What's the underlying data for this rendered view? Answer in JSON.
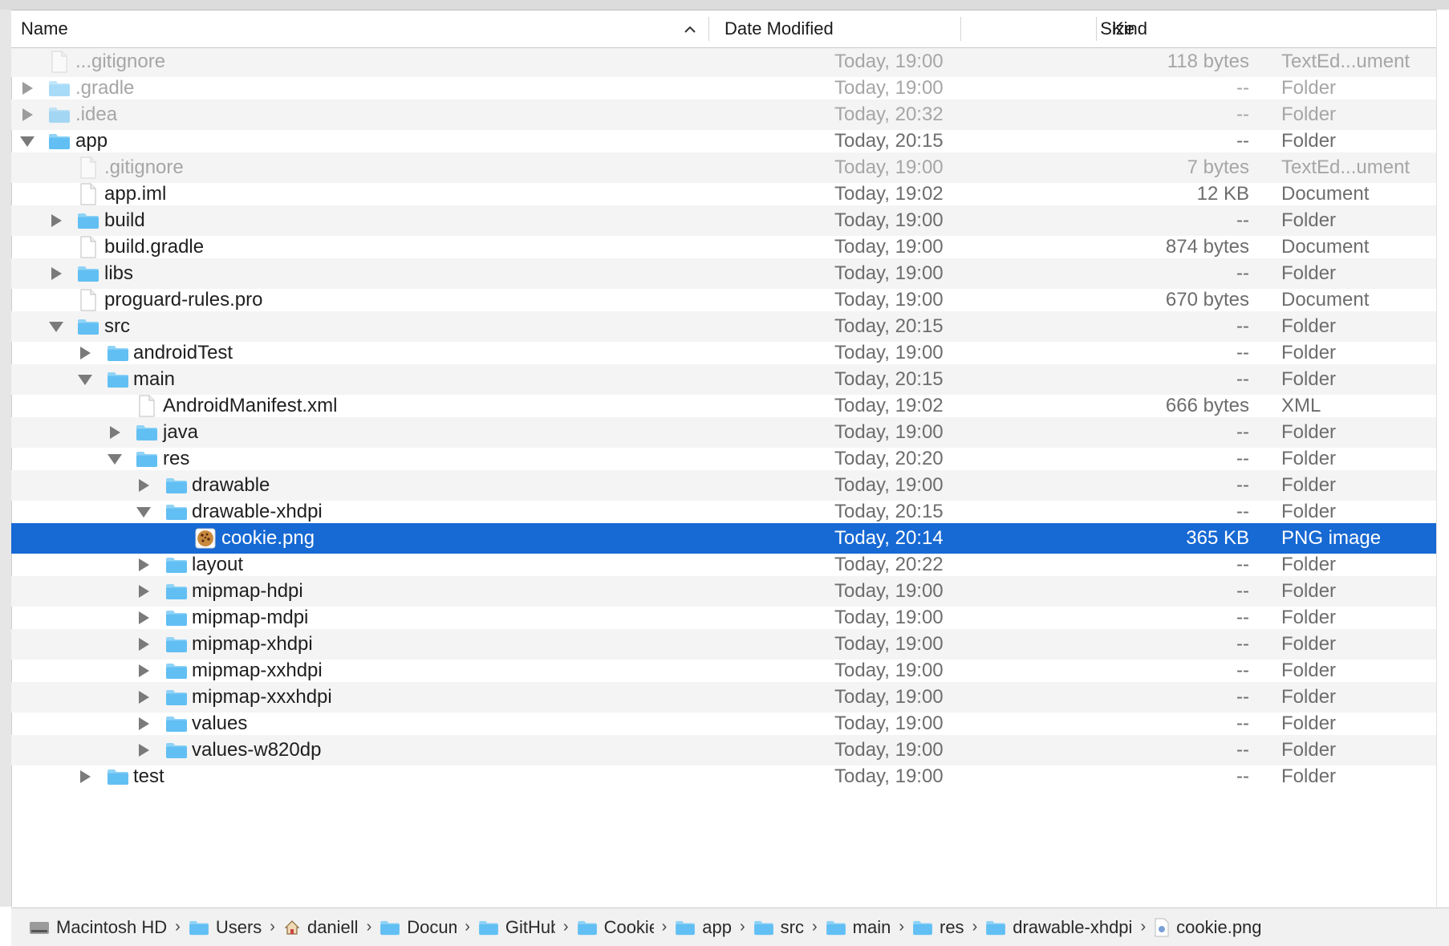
{
  "header": {
    "name": "Name",
    "date_modified": "Date Modified",
    "size": "Size",
    "kind": "Kind"
  },
  "rows": [
    {
      "name": "...gitignore",
      "date": "Today, 19:00",
      "size": "118 bytes",
      "kind": "TextEd...ument",
      "icon": "document-icon",
      "dim": true,
      "disclosure": "none"
    },
    {
      "name": ".gradle",
      "date": "Today, 19:00",
      "size": "--",
      "kind": "Folder",
      "icon": "folder-icon",
      "dim": true,
      "disclosure": "collapsed"
    },
    {
      "name": ".idea",
      "date": "Today, 20:32",
      "size": "--",
      "kind": "Folder",
      "icon": "folder-icon",
      "dim": true,
      "disclosure": "collapsed"
    },
    {
      "name": "app",
      "date": "Today, 20:15",
      "size": "--",
      "kind": "Folder",
      "icon": "folder-icon",
      "dim": false,
      "disclosure": "expanded"
    },
    {
      "name": ".gitignore",
      "date": "Today, 19:00",
      "size": "7 bytes",
      "kind": "TextEd...ument",
      "icon": "document-icon",
      "dim": true,
      "disclosure": "none"
    },
    {
      "name": "app.iml",
      "date": "Today, 19:02",
      "size": "12 KB",
      "kind": "Document",
      "icon": "document-icon",
      "dim": false,
      "disclosure": "none"
    },
    {
      "name": "build",
      "date": "Today, 19:00",
      "size": "--",
      "kind": "Folder",
      "icon": "folder-icon",
      "dim": false,
      "disclosure": "collapsed"
    },
    {
      "name": "build.gradle",
      "date": "Today, 19:00",
      "size": "874 bytes",
      "kind": "Document",
      "icon": "document-icon",
      "dim": false,
      "disclosure": "none"
    },
    {
      "name": "libs",
      "date": "Today, 19:00",
      "size": "--",
      "kind": "Folder",
      "icon": "folder-icon",
      "dim": false,
      "disclosure": "collapsed"
    },
    {
      "name": "proguard-rules.pro",
      "date": "Today, 19:00",
      "size": "670 bytes",
      "kind": "Document",
      "icon": "document-icon",
      "dim": false,
      "disclosure": "none"
    },
    {
      "name": "src",
      "date": "Today, 20:15",
      "size": "--",
      "kind": "Folder",
      "icon": "folder-icon",
      "dim": false,
      "disclosure": "expanded"
    },
    {
      "name": "androidTest",
      "date": "Today, 19:00",
      "size": "--",
      "kind": "Folder",
      "icon": "folder-icon",
      "dim": false,
      "disclosure": "collapsed"
    },
    {
      "name": "main",
      "date": "Today, 20:15",
      "size": "--",
      "kind": "Folder",
      "icon": "folder-icon",
      "dim": false,
      "disclosure": "expanded"
    },
    {
      "name": "AndroidManifest.xml",
      "date": "Today, 19:02",
      "size": "666 bytes",
      "kind": "XML",
      "icon": "document-icon",
      "dim": false,
      "disclosure": "none"
    },
    {
      "name": "java",
      "date": "Today, 19:00",
      "size": "--",
      "kind": "Folder",
      "icon": "folder-icon",
      "dim": false,
      "disclosure": "collapsed"
    },
    {
      "name": "res",
      "date": "Today, 20:20",
      "size": "--",
      "kind": "Folder",
      "icon": "folder-icon",
      "dim": false,
      "disclosure": "expanded"
    },
    {
      "name": "drawable",
      "date": "Today, 19:00",
      "size": "--",
      "kind": "Folder",
      "icon": "folder-icon",
      "dim": false,
      "disclosure": "collapsed"
    },
    {
      "name": "drawable-xhdpi",
      "date": "Today, 20:15",
      "size": "--",
      "kind": "Folder",
      "icon": "folder-icon",
      "dim": false,
      "disclosure": "expanded"
    },
    {
      "name": "cookie.png",
      "date": "Today, 20:14",
      "size": "365 KB",
      "kind": "PNG image",
      "icon": "cookie-image-icon",
      "dim": false,
      "disclosure": "none",
      "selected": true
    },
    {
      "name": "layout",
      "date": "Today, 20:22",
      "size": "--",
      "kind": "Folder",
      "icon": "folder-icon",
      "dim": false,
      "disclosure": "collapsed"
    },
    {
      "name": "mipmap-hdpi",
      "date": "Today, 19:00",
      "size": "--",
      "kind": "Folder",
      "icon": "folder-icon",
      "dim": false,
      "disclosure": "collapsed"
    },
    {
      "name": "mipmap-mdpi",
      "date": "Today, 19:00",
      "size": "--",
      "kind": "Folder",
      "icon": "folder-icon",
      "dim": false,
      "disclosure": "collapsed"
    },
    {
      "name": "mipmap-xhdpi",
      "date": "Today, 19:00",
      "size": "--",
      "kind": "Folder",
      "icon": "folder-icon",
      "dim": false,
      "disclosure": "collapsed"
    },
    {
      "name": "mipmap-xxhdpi",
      "date": "Today, 19:00",
      "size": "--",
      "kind": "Folder",
      "icon": "folder-icon",
      "dim": false,
      "disclosure": "collapsed"
    },
    {
      "name": "mipmap-xxxhdpi",
      "date": "Today, 19:00",
      "size": "--",
      "kind": "Folder",
      "icon": "folder-icon",
      "dim": false,
      "disclosure": "collapsed"
    },
    {
      "name": "values",
      "date": "Today, 19:00",
      "size": "--",
      "kind": "Folder",
      "icon": "folder-icon",
      "dim": false,
      "disclosure": "collapsed"
    },
    {
      "name": "values-w820dp",
      "date": "Today, 19:00",
      "size": "--",
      "kind": "Folder",
      "icon": "folder-icon",
      "dim": false,
      "disclosure": "collapsed"
    },
    {
      "name": "test",
      "date": "Today, 19:00",
      "size": "--",
      "kind": "Folder",
      "icon": "folder-icon",
      "dim": false,
      "disclosure": "collapsed"
    }
  ],
  "pathbar": [
    {
      "label": "Macintosh HD",
      "icon": "hard-drive-icon"
    },
    {
      "label": "Users",
      "icon": "users-folder-icon"
    },
    {
      "label": "daniell",
      "icon": "home-icon"
    },
    {
      "label": "Docum",
      "icon": "documents-folder-icon"
    },
    {
      "label": "GitHub",
      "icon": "folder-icon"
    },
    {
      "label": "Cookie",
      "icon": "folder-icon"
    },
    {
      "label": "app",
      "icon": "folder-icon"
    },
    {
      "label": "src",
      "icon": "folder-icon"
    },
    {
      "label": "main",
      "icon": "folder-icon"
    },
    {
      "label": "res",
      "icon": "folder-icon"
    },
    {
      "label": "drawable-xhdpi",
      "icon": "folder-icon"
    },
    {
      "label": "cookie.png",
      "icon": "image-file-icon"
    }
  ],
  "colors": {
    "selection": "#1769d3",
    "folder_fill": "#62bff3",
    "folder_tab": "#8fd3f7",
    "alt_row": "#f4f4f4"
  }
}
